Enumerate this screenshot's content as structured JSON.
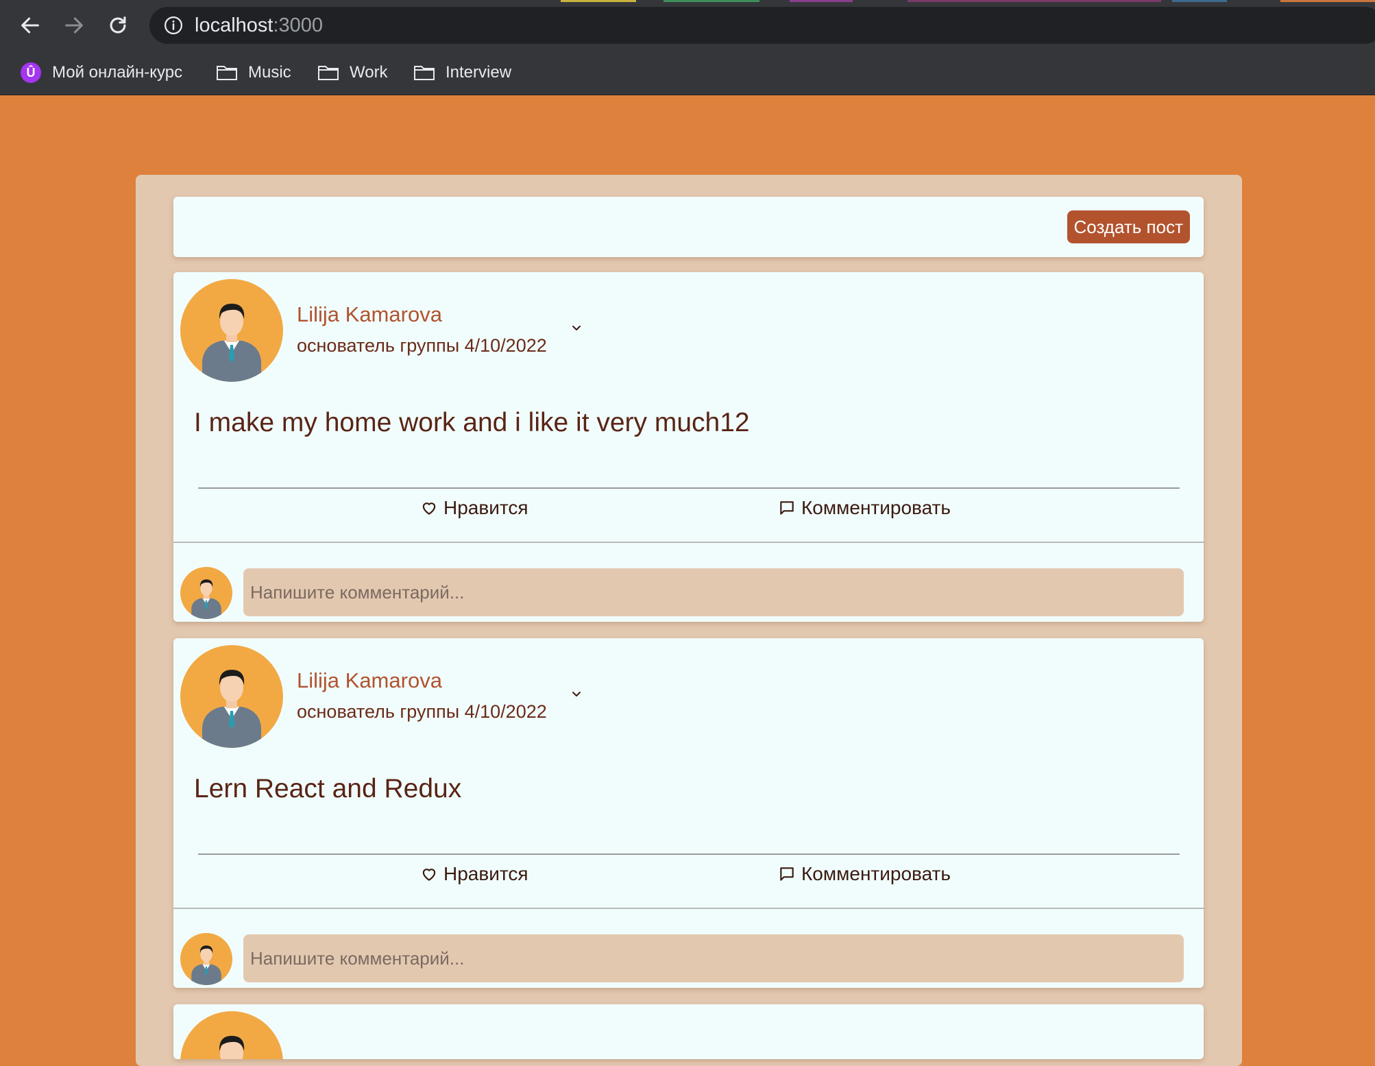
{
  "browser": {
    "url_host": "localhost",
    "url_port": ":3000",
    "bookmarks": [
      {
        "label": "Мой онлайн-курс",
        "icon": "udemy-logo"
      },
      {
        "label": "Music",
        "icon": "folder-icon"
      },
      {
        "label": "Work",
        "icon": "folder-icon"
      },
      {
        "label": "Interview",
        "icon": "folder-icon"
      }
    ],
    "udemy_letter": "Û"
  },
  "colors": {
    "page_bg": "#de813d",
    "container_bg": "#e3c8b0",
    "card_bg": "#f1fdfd",
    "button_bg": "#b2532e",
    "author": "#b2532e",
    "avatar_bg": "#f2a944"
  },
  "header": {
    "create_post_label": "Создать пост"
  },
  "posts": [
    {
      "author": "Lilija Kamarova",
      "meta": "основатель группы 4/10/2022",
      "text": "I make my home work and i like it very much12",
      "like_label": "Нравится",
      "comment_label": "Комментировать",
      "comment_placeholder": "Напишите комментарий..."
    },
    {
      "author": "Lilija Kamarova",
      "meta": "основатель группы 4/10/2022",
      "text": "Lern React and Redux",
      "like_label": "Нравится",
      "comment_label": "Комментировать",
      "comment_placeholder": "Напишите комментарий..."
    }
  ]
}
